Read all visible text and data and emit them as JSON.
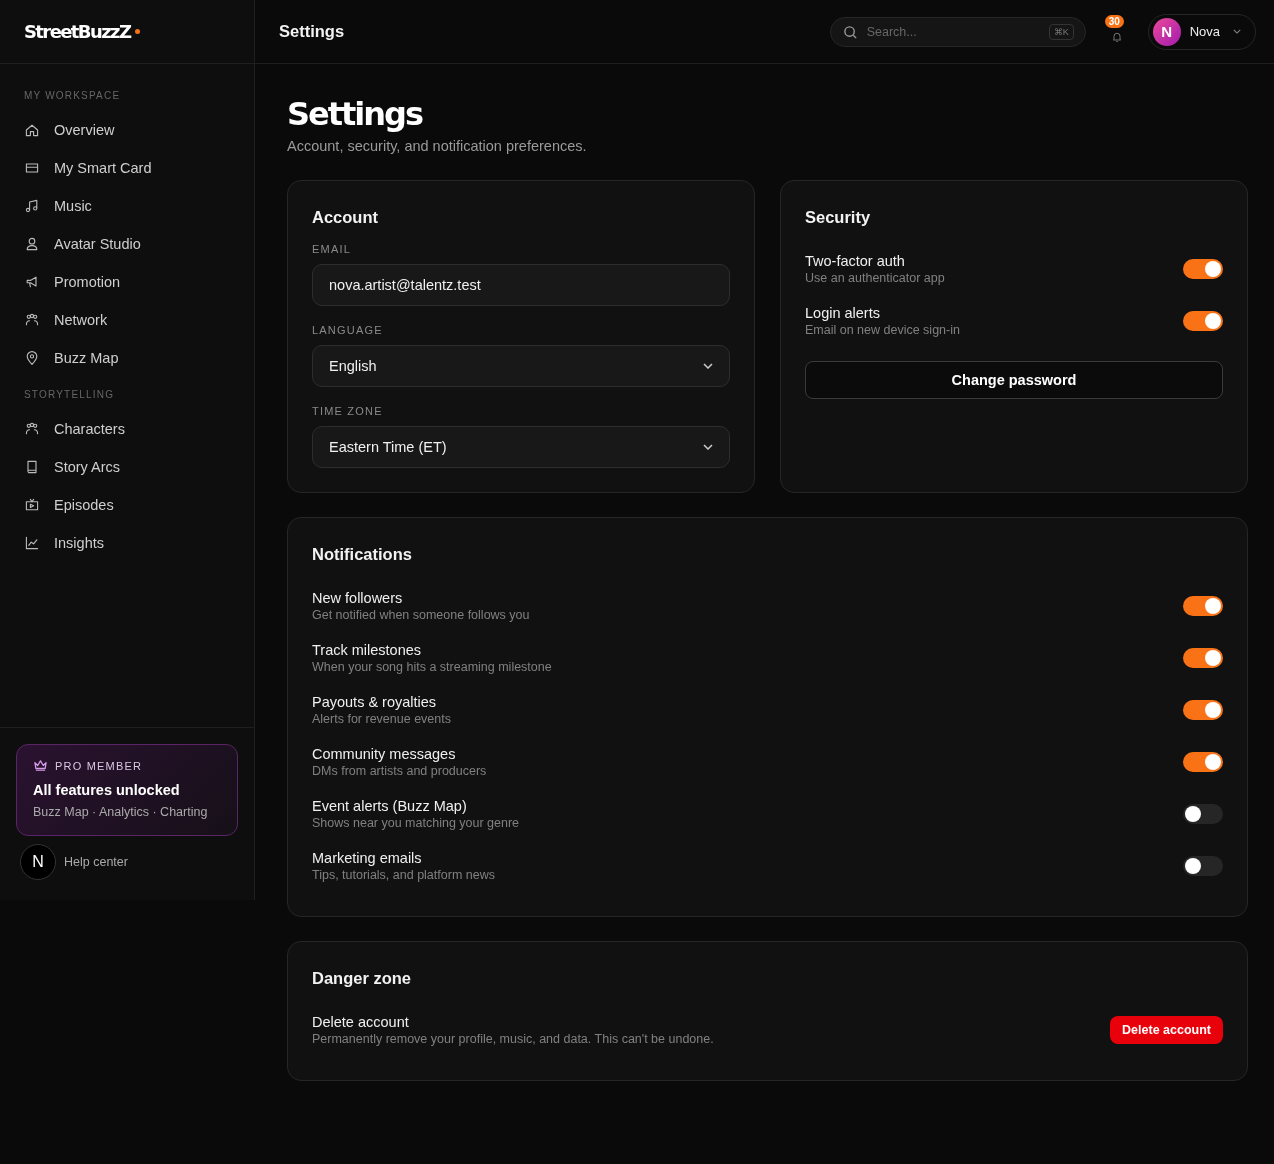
{
  "brand": {
    "name": "StreetBuzzZ"
  },
  "topbar": {
    "title": "Settings",
    "search": {
      "placeholder": "Search...",
      "shortcut": "⌘K"
    },
    "notifications": {
      "count": "30"
    },
    "user": {
      "initial": "N",
      "name": "Nova"
    }
  },
  "sidebar": {
    "sections": [
      {
        "title": "MY WORKSPACE",
        "items": [
          {
            "label": "Overview",
            "selected": false
          },
          {
            "label": "My Smart Card",
            "selected": false
          },
          {
            "label": "Music",
            "selected": false
          },
          {
            "label": "Avatar Studio",
            "selected": false
          },
          {
            "label": "Promotion",
            "selected": false
          },
          {
            "label": "Network",
            "selected": false
          },
          {
            "label": "Buzz Map",
            "selected": false
          }
        ]
      },
      {
        "title": "STORYTELLING",
        "items": [
          {
            "label": "Characters",
            "selected": false
          },
          {
            "label": "Story Arcs",
            "selected": false
          },
          {
            "label": "Episodes",
            "selected": false
          },
          {
            "label": "Insights",
            "selected": false
          }
        ]
      }
    ],
    "promo": {
      "badge": "PRO MEMBER",
      "title": "All features unlocked",
      "subtitle": "Buzz Map · Analytics · Charting"
    },
    "help": {
      "label": "Help center",
      "avatar": "N"
    }
  },
  "page": {
    "title": "Settings",
    "subtitle": "Account, security, and notification preferences."
  },
  "account": {
    "title": "Account",
    "fields": [
      {
        "kind": "input",
        "label": "EMAIL",
        "value": "nova.artist@talentz.test"
      },
      {
        "kind": "select",
        "label": "LANGUAGE",
        "value": "English"
      },
      {
        "kind": "select",
        "label": "TIME ZONE",
        "value": "Eastern Time (ET)"
      }
    ]
  },
  "security": {
    "title": "Security",
    "toggles": [
      {
        "label": "Two-factor auth",
        "description": "Use an authenticator app",
        "on": true
      },
      {
        "label": "Login alerts",
        "description": "Email on new device sign-in",
        "on": true
      }
    ],
    "button": "Change password"
  },
  "notifications": {
    "title": "Notifications",
    "toggles": [
      {
        "label": "New followers",
        "description": "Get notified when someone follows you",
        "on": true
      },
      {
        "label": "Track milestones",
        "description": "When your song hits a streaming milestone",
        "on": true
      },
      {
        "label": "Payouts & royalties",
        "description": "Alerts for revenue events",
        "on": true
      },
      {
        "label": "Community messages",
        "description": "DMs from artists and producers",
        "on": true
      },
      {
        "label": "Event alerts (Buzz Map)",
        "description": "Shows near you matching your genre",
        "on": false
      },
      {
        "label": "Marketing emails",
        "description": "Tips, tutorials, and platform news",
        "on": false
      }
    ]
  },
  "danger": {
    "title": "Danger zone",
    "label": "Delete account",
    "description": "Permanently remove your profile, music, and data. This can't be undone.",
    "button": "Delete account"
  }
}
